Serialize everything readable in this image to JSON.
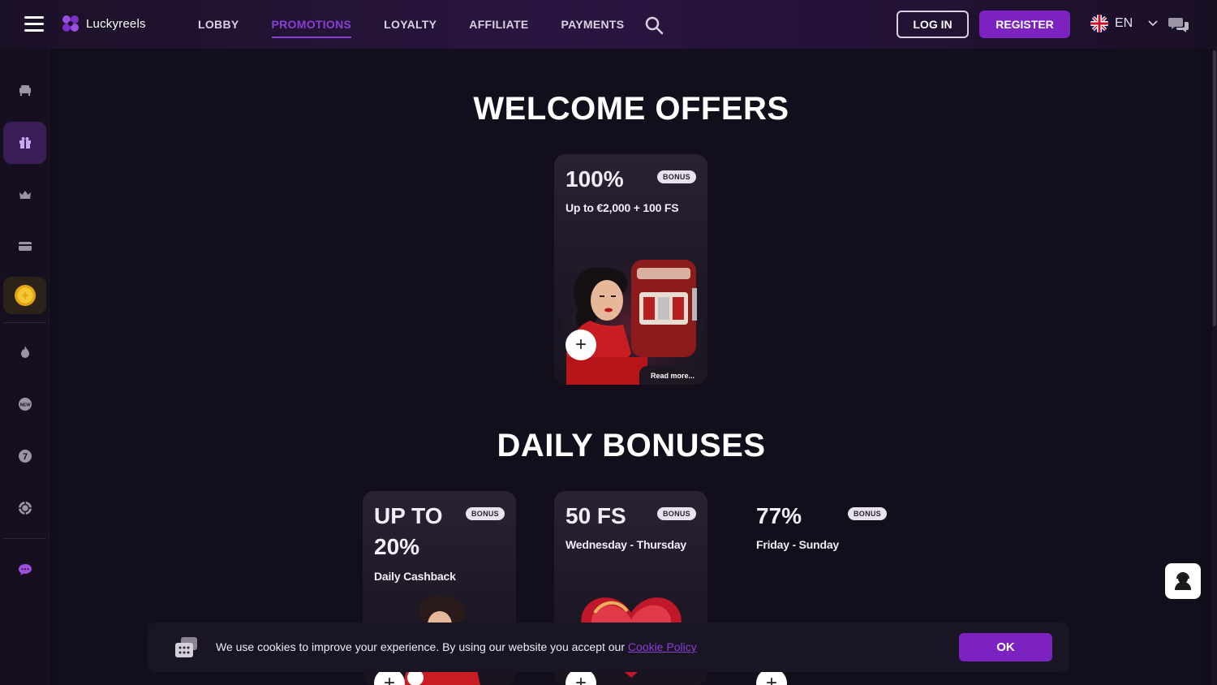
{
  "header": {
    "brand": "Luckyreels",
    "nav": [
      {
        "label": "LOBBY"
      },
      {
        "label": "PROMOTIONS"
      },
      {
        "label": "LOYALTY"
      },
      {
        "label": "AFFILIATE"
      },
      {
        "label": "PAYMENTS"
      }
    ],
    "active_nav": "PROMOTIONS",
    "login_label": "LOG IN",
    "register_label": "REGISTER",
    "language": "EN",
    "accent_color": "#7b22c0"
  },
  "sidebar": {
    "icons": [
      "sofa-icon",
      "gift-icon",
      "crown-icon",
      "card-icon",
      "coin-icon",
      "fire-icon",
      "new-icon",
      "seven-icon",
      "chip-icon",
      "chat-bubble-icon"
    ]
  },
  "welcome": {
    "title": "WELCOME OFFERS",
    "cards": [
      {
        "headline": "100%",
        "badge": "BONUS",
        "subtitle": "Up to €2,000 + 100 FS",
        "read_more": "Read more..."
      }
    ]
  },
  "daily": {
    "title": "DAILY BONUSES",
    "cards": [
      {
        "headline_line1": "UP TO",
        "headline_line2": "20%",
        "badge": "BONUS",
        "subtitle": "Daily Cashback"
      },
      {
        "headline": "50 FS",
        "badge": "BONUS",
        "subtitle": "Wednesday - Thursday"
      },
      {
        "headline": "77%",
        "badge": "BONUS",
        "subtitle": "Friday - Sunday"
      }
    ]
  },
  "cookie": {
    "text": "We use cookies to improve your experience. By using our website you accept our",
    "link": "Cookie Policy",
    "ok_label": "OK"
  }
}
